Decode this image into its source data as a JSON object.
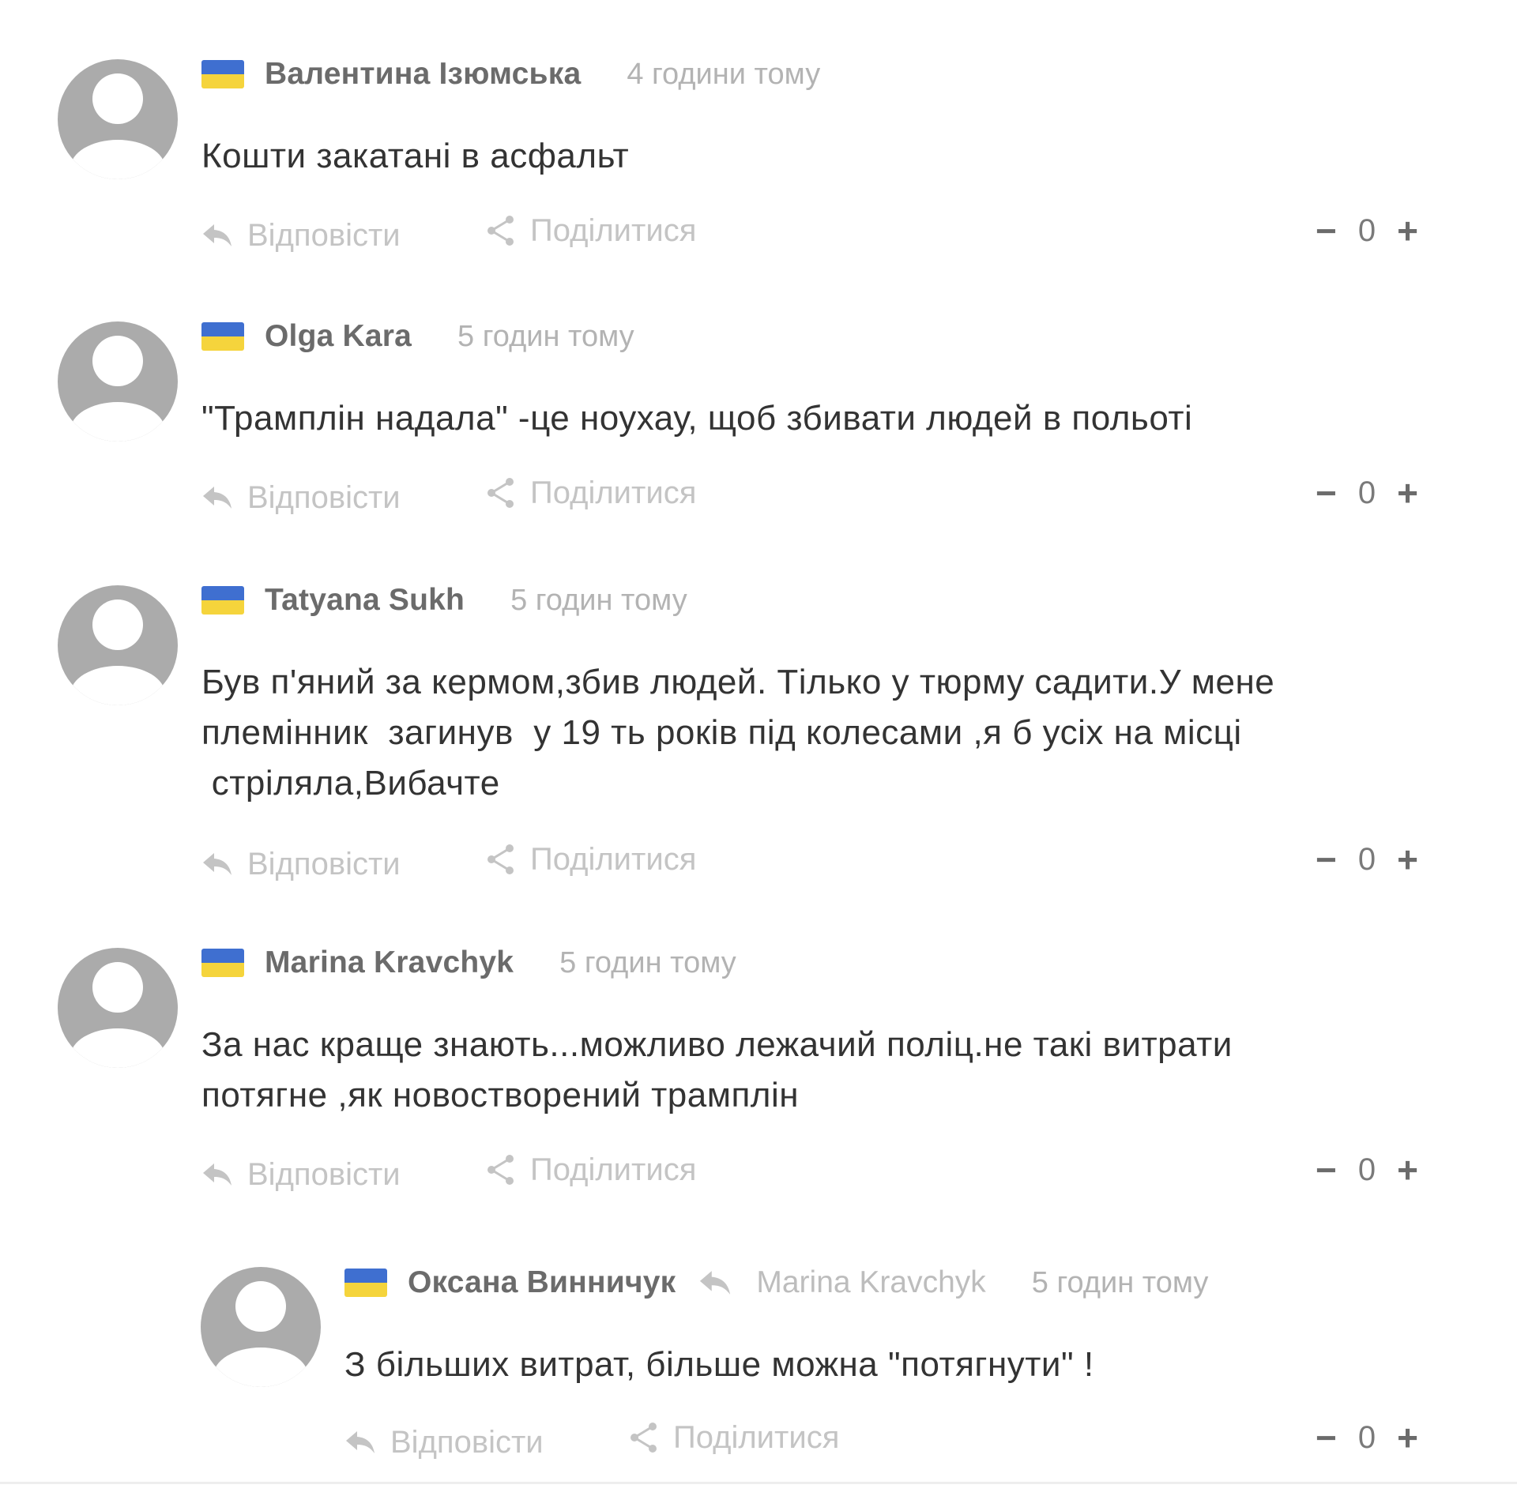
{
  "colors": {
    "flag_blue": "#3f6fd0",
    "flag_yellow": "#f5d43c",
    "avatar_gray": "#ababab",
    "author_text": "#6b6b6b",
    "muted_text": "#b3b3b3",
    "body_text": "#333333"
  },
  "icons": {
    "reply": "reply-arrow-icon",
    "share": "share-icon",
    "flag": "ukraine-flag-icon",
    "avatar": "default-user-avatar-icon"
  },
  "labels": {
    "reply": "Відповісти",
    "share": "Поділитися",
    "minus": "−",
    "plus": "+"
  },
  "comments": [
    {
      "author": "Валентина Ізюмська",
      "time": "4 години тому",
      "text": "Кошти закатані в асфальт",
      "votes": "0"
    },
    {
      "author": "Olga Kara",
      "time": "5 годин тому",
      "text": "\"Трамплін надала\" -це ноухау, щоб збивати людей в польоті",
      "votes": "0"
    },
    {
      "author": "Tatyana Sukh",
      "time": "5 годин тому",
      "text": "Був п'яний за кермом,збив людей. Тілько у тюрму садити.У мене\nплемінник  загинув  у 19 ть років під колесами ,я б усіх на місці\n стріляла,Вибачте",
      "votes": "0"
    },
    {
      "author": "Marina Kravchyk",
      "time": "5 годин тому",
      "text": "За нас краще знають...можливо лежачий поліц.не такі витрати\nпотягне ,як новостворений трамплін",
      "votes": "0"
    },
    {
      "author": "Оксана Винничук",
      "reply_to": "Marina Kravchyk",
      "time": "5 годин тому",
      "text": "З більших витрат, більше можна \"потягнути\" !",
      "votes": "0"
    }
  ]
}
